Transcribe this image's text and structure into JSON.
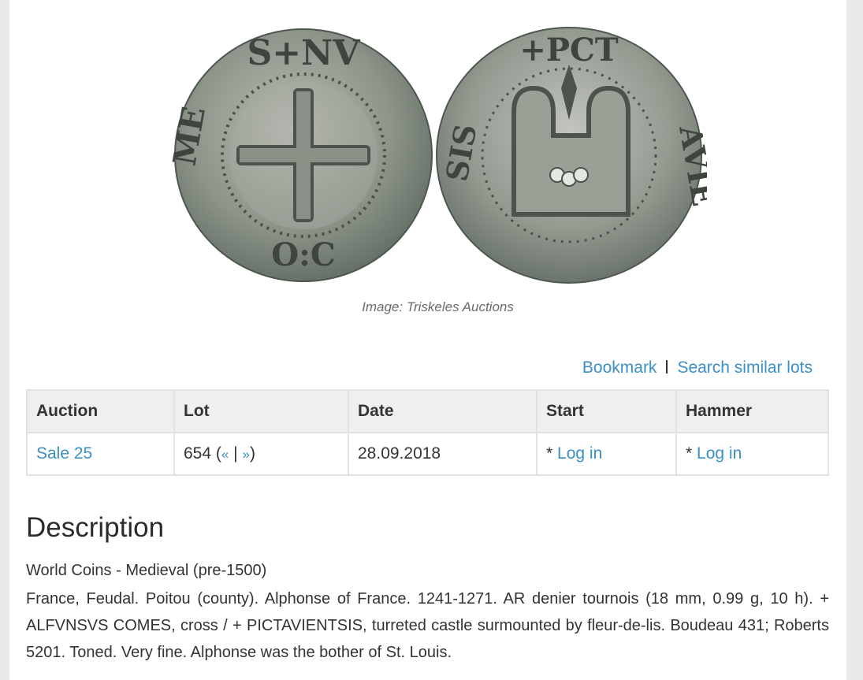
{
  "image": {
    "caption": "Image: Triskeles Auctions"
  },
  "actions": {
    "bookmark": "Bookmark",
    "search_similar": "Search similar lots"
  },
  "table": {
    "headers": {
      "auction": "Auction",
      "lot": "Lot",
      "date": "Date",
      "start": "Start",
      "hammer": "Hammer"
    },
    "row": {
      "auction": "Sale 25",
      "lot_number": "654",
      "prev": "«",
      "next": "»",
      "date": "28.09.2018",
      "start_prefix": "*",
      "start_link": "Log in",
      "hammer_prefix": "*",
      "hammer_link": "Log in"
    }
  },
  "description": {
    "heading": "Description",
    "category": "World Coins - Medieval (pre-1500)",
    "text": "France, Feudal. Poitou (county). Alphonse of France. 1241-1271. AR denier tournois (18 mm, 0.99 g, 10 h). + ALFVNSVS COMES, cross / + PICTAVIENTSIS, turreted castle surmounted by fleur-de-lis. Boudeau 431; Roberts 5201. Toned. Very fine. Alphonse was the bother of St. Louis."
  }
}
